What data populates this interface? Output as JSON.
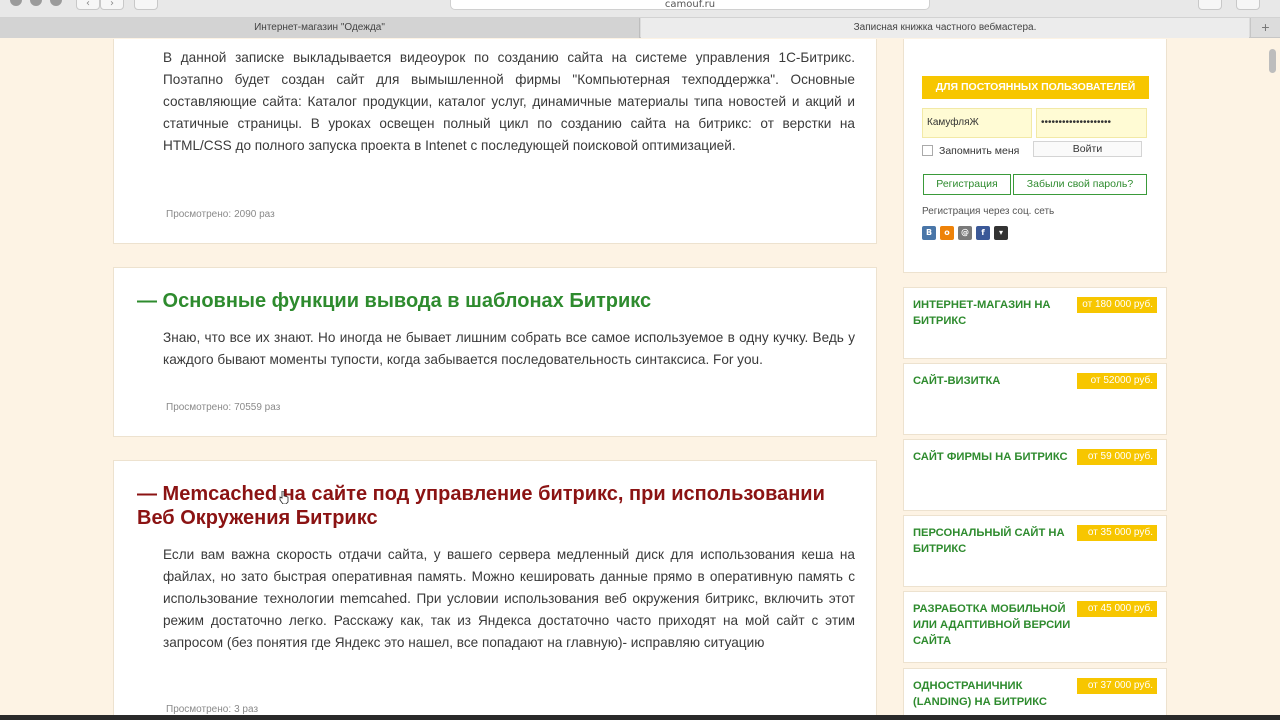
{
  "browser": {
    "url": "camouf.ru",
    "tabs": [
      {
        "label": "Интернет-магазин \"Одежда\""
      },
      {
        "label": "Записная книжка частного вебмастера."
      }
    ],
    "new_tab_label": "+"
  },
  "articles": [
    {
      "title": "",
      "text": "В данной записке выкладывается видеоурок по созданию сайта на системе управления 1С-Битрикс. Поэтапно будет создан сайт для вымышленной фирмы \"Компьютерная техподдержка\". Основные составляющие сайта: Каталог продукции, каталог услуг, динамичные материалы типа новостей и акций и статичные страницы. В уроках освещен полный цикл по созданию сайта на битрикс: от верстки на HTML/CSS до полного запуска проекта в Intenet с последующей поисковой оптимизацией.",
      "views_label": "Просмотрено:",
      "views_count": "2090 раз"
    },
    {
      "title": "— Основные функции вывода в шаблонах Битрикс",
      "text": "Знаю, что все их знают. Но иногда не бывает лишним собрать все самое используемое в одну кучку. Ведь у каждого бывают моменты тупости, когда забывается последовательность синтаксиса. For you.",
      "views_label": "Просмотрено:",
      "views_count": "70559 раз"
    },
    {
      "title": "— Memcached на сайте под управление битрикс, при использовании Веб Окружения Битрикс",
      "text": "Если вам важна скорость отдачи сайта, у вашего сервера медленный диск для использования кеша на файлах, но зато быстрая оперативная память. Можно кешировать данные прямо в оперативную память с использование технологии memcahed. При условии использования веб окружения битрикс, включить этот режим достаточно легко. Расскажу как, так из Яндекса достаточно часто приходят на мой сайт с этим запросом (без понятия где Яндекс это нашел, все попадают на главную)- исправляю ситуацию",
      "views_label": "Просмотрено:",
      "views_count": "3 раз"
    }
  ],
  "login": {
    "header": "ДЛЯ ПОСТОЯННЫХ ПОЛЬЗОВАТЕЛЕЙ",
    "username": "КамуфляЖ",
    "password": "••••••••••••••••••••",
    "remember_label": "Запомнить меня",
    "login_button": "Войти",
    "register_button": "Регистрация",
    "forgot_button": "Забыли свой пароль?",
    "social_label": "Регистрация через соц. сеть",
    "social": [
      {
        "icon": "vk-icon",
        "glyph": "B",
        "color": "#4a76a8"
      },
      {
        "icon": "odnoklassniki-icon",
        "glyph": "o",
        "color": "#ee8208"
      },
      {
        "icon": "mailru-icon",
        "glyph": "@",
        "color": "#7a7a7a"
      },
      {
        "icon": "facebook-icon",
        "glyph": "f",
        "color": "#3b5998"
      },
      {
        "icon": "more-icon",
        "glyph": "▾",
        "color": "#333333"
      }
    ]
  },
  "prices": [
    {
      "name": "ИНТЕРНЕТ-МАГАЗИН НА БИТРИКС",
      "price": "от 180 000 руб."
    },
    {
      "name": "САЙТ-ВИЗИТКА",
      "price": "от 52000 руб."
    },
    {
      "name": "САЙТ ФИРМЫ НА БИТРИКС",
      "price": "от 59 000 руб."
    },
    {
      "name": "ПЕРСОНАЛЬНЫЙ САЙТ НА БИТРИКС",
      "price": "от 35 000 руб."
    },
    {
      "name": "РАЗРАБОТКА МОБИЛЬНОЙ ИЛИ АДАПТИВНОЙ ВЕРСИИ САЙТА",
      "price": "от 45 000 руб."
    },
    {
      "name": "ОДНОСТРАНИЧНИК (LANDING) НА БИТРИКС",
      "price": "от 37 000 руб."
    }
  ],
  "colors": {
    "accent_green": "#2e8b2e",
    "accent_red": "#8b1313",
    "accent_yellow": "#f7c600",
    "page_bg": "#fdf3e4"
  }
}
